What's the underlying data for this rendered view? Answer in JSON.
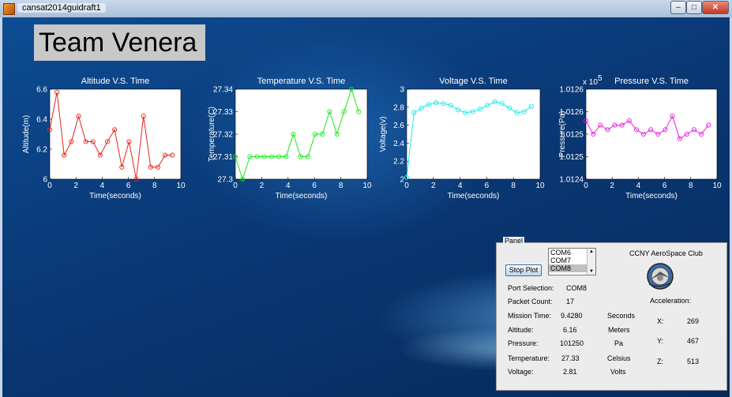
{
  "window": {
    "title": "cansat2014guidraft1",
    "buttons": {
      "minimize": "–",
      "maximize": "□",
      "close": "✕"
    }
  },
  "team_title": "Team Venera",
  "chart_data": [
    {
      "type": "line",
      "title": "Altitude V.S. Time",
      "xlabel": "Time(seconds)",
      "ylabel": "Altitude(m)",
      "xlim": [
        0,
        10
      ],
      "ylim": [
        6,
        6.6
      ],
      "xticks": [
        "0",
        "2",
        "4",
        "6",
        "8",
        "10"
      ],
      "yticks": [
        "6",
        "6.2",
        "6.4",
        "6.6"
      ],
      "color": "#e8231a",
      "x": [
        0,
        0.55,
        1.1,
        1.65,
        2.2,
        2.75,
        3.3,
        3.85,
        4.4,
        4.95,
        5.5,
        6.05,
        6.6,
        7.15,
        7.7,
        8.25,
        8.8,
        9.35
      ],
      "y": [
        6.33,
        6.58,
        6.16,
        6.25,
        6.42,
        6.25,
        6.25,
        6.16,
        6.25,
        6.33,
        6.08,
        6.25,
        6.0,
        6.42,
        6.08,
        6.08,
        6.16,
        6.16
      ]
    },
    {
      "type": "line",
      "title": "Temperature V.S. Time",
      "xlabel": "Time(seconds)",
      "ylabel": "Temperature(C)",
      "xlim": [
        0,
        10
      ],
      "ylim": [
        27.3,
        27.34
      ],
      "xticks": [
        "0",
        "2",
        "4",
        "6",
        "8",
        "10"
      ],
      "yticks": [
        "27.3",
        "27.31",
        "27.32",
        "27.33",
        "27.34"
      ],
      "color": "#18e81a",
      "x": [
        0,
        0.55,
        1.1,
        1.65,
        2.2,
        2.75,
        3.3,
        3.85,
        4.4,
        4.95,
        5.5,
        6.05,
        6.6,
        7.15,
        7.7,
        8.25,
        8.8,
        9.35
      ],
      "y": [
        27.31,
        27.3,
        27.31,
        27.31,
        27.31,
        27.31,
        27.31,
        27.31,
        27.32,
        27.31,
        27.31,
        27.32,
        27.32,
        27.33,
        27.32,
        27.33,
        27.34,
        27.33
      ]
    },
    {
      "type": "line",
      "title": "Voltage V.S. Time",
      "xlabel": "Time(seconds)",
      "ylabel": "Voltage(v)",
      "xlim": [
        0,
        10
      ],
      "ylim": [
        2,
        3
      ],
      "xticks": [
        "0",
        "2",
        "4",
        "6",
        "8",
        "10"
      ],
      "yticks": [
        "2",
        "2.2",
        "2.4",
        "2.6",
        "2.8",
        "3"
      ],
      "color": "#1ee8e8",
      "x": [
        0,
        0.55,
        1.1,
        1.65,
        2.2,
        2.75,
        3.3,
        3.85,
        4.4,
        4.95,
        5.5,
        6.05,
        6.6,
        7.15,
        7.7,
        8.25,
        8.8,
        9.35
      ],
      "y": [
        2.02,
        2.74,
        2.79,
        2.83,
        2.85,
        2.84,
        2.82,
        2.77,
        2.74,
        2.75,
        2.78,
        2.82,
        2.86,
        2.84,
        2.79,
        2.74,
        2.75,
        2.81
      ]
    },
    {
      "type": "line",
      "title": "Pressure V.S. Time",
      "xlabel": "Time(seconds)",
      "ylabel": "Pressure(Pa)",
      "xlim": [
        0,
        10
      ],
      "ylim": [
        1.0124,
        1.0126
      ],
      "xticks": [
        "0",
        "2",
        "4",
        "6",
        "8",
        "10"
      ],
      "yticks": [
        "1.0124",
        "1.0125",
        "1.0125",
        "1.0126",
        "1.0126"
      ],
      "ytick_values": [
        1.0124,
        1.01245,
        1.0125,
        1.01255,
        1.0126
      ],
      "exponent_label": "x 10",
      "exponent_power": "5",
      "color": "#e81ee0",
      "x": [
        0,
        0.55,
        1.1,
        1.65,
        2.2,
        2.75,
        3.3,
        3.85,
        4.4,
        4.95,
        5.5,
        6.05,
        6.6,
        7.15,
        7.7,
        8.25,
        8.8,
        9.35
      ],
      "y": [
        1.01253,
        1.0125,
        1.01252,
        1.01251,
        1.01252,
        1.01252,
        1.01253,
        1.01251,
        1.0125,
        1.01251,
        1.0125,
        1.01251,
        1.01254,
        1.01249,
        1.0125,
        1.01251,
        1.0125,
        1.01252
      ]
    }
  ],
  "panel": {
    "legend": "Panel",
    "stop_button": "Stop Plot",
    "port_options": [
      "COM6",
      "COM7",
      "COM8"
    ],
    "selected_port_index": 2,
    "club_name": "CCNY AeroSpace Club",
    "labels": {
      "port_selection": "Port Selection:",
      "packet_count": "Packet Count:",
      "mission_time": "Mission Time:",
      "altitude": "Altitude:",
      "pressure": "Pressure:",
      "temperature": "Temperature:",
      "voltage": "Voltage:",
      "acceleration": "Acceleration:",
      "x": "X:",
      "y": "Y:",
      "z": "Z:"
    },
    "values": {
      "port_selection": "COM8",
      "packet_count": "17",
      "mission_time": "9.4280",
      "altitude": "6.16",
      "pressure": "101250",
      "temperature": "27.33",
      "voltage": "2.81",
      "x": "269",
      "y": "467",
      "z": "513"
    },
    "units": {
      "mission_time": "Seconds",
      "altitude": "Meters",
      "pressure": "Pa",
      "temperature": "Celsius",
      "voltage": "Volts"
    }
  }
}
